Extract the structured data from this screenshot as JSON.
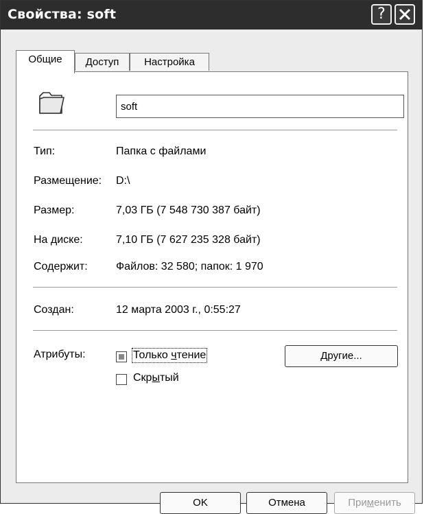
{
  "window": {
    "title": "Свойства: soft"
  },
  "tabs": [
    {
      "label": "Общие"
    },
    {
      "label": "Доступ"
    },
    {
      "label": "Настройка"
    }
  ],
  "folder": {
    "name": "soft",
    "icon": "folder-icon"
  },
  "props": {
    "type_label": "Тип:",
    "type_value": "Папка с файлами",
    "location_label": "Размещение:",
    "location_value": "D:\\",
    "size_label": "Размер:",
    "size_value": "7,03 ГБ (7 548 730 387 байт)",
    "ondisk_label": "На диске:",
    "ondisk_value": "7,10 ГБ (7 627 235 328 байт)",
    "contains_label": "Содержит:",
    "contains_value": "Файлов: 32 580; папок: 1 970",
    "created_label": "Создан:",
    "created_value": "12 марта 2003 г., 0:55:27"
  },
  "attributes": {
    "label": "Атрибуты:",
    "readonly_pre": "Только ",
    "readonly_u": "ч",
    "readonly_post": "тение",
    "hidden_pre": "Скр",
    "hidden_u": "ы",
    "hidden_post": "тый",
    "other_u": "Д",
    "other_post": "ругие..."
  },
  "buttons": {
    "ok": "OK",
    "cancel": "Отмена",
    "apply_pre": "При",
    "apply_u": "м",
    "apply_post": "енить"
  }
}
